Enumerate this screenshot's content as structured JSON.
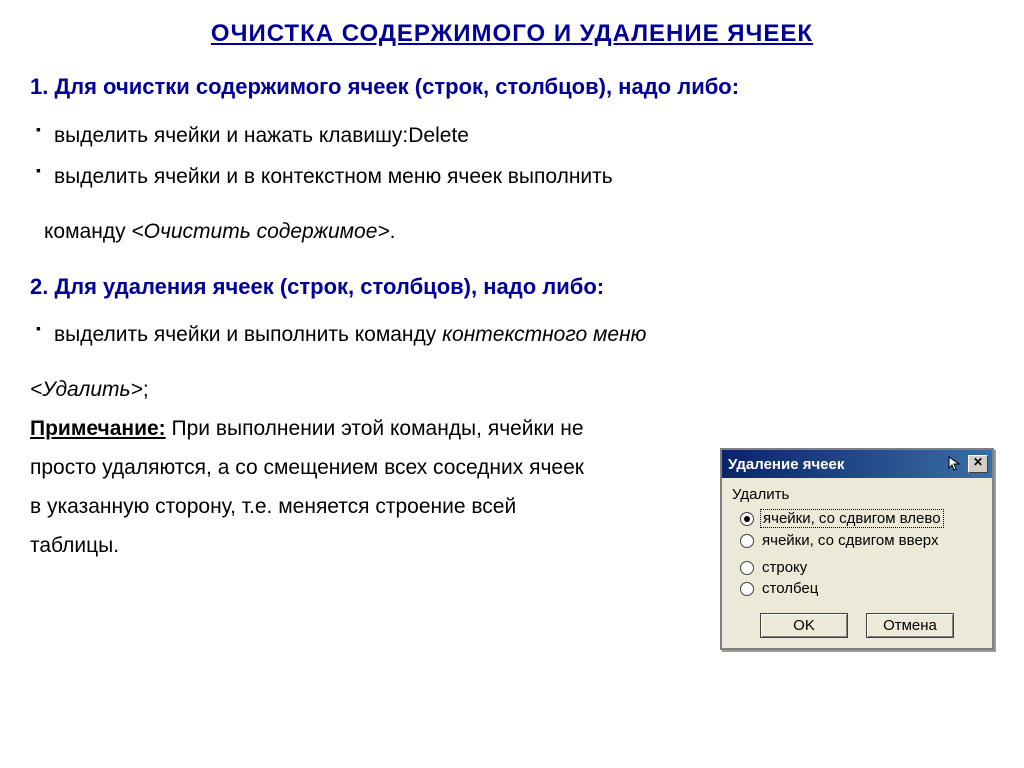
{
  "title": "ОЧИСТКА СОДЕРЖИМОГО И УДАЛЕНИЕ ЯЧЕЕК",
  "section1": {
    "heading": "1. Для очистки содержимого ячеек (строк, столбцов), надо либо:",
    "bullet1": "выделить ячейки и нажать клавишу:Delete",
    "bullet2a": "выделить ячейки и в контекстном меню ячеек выполнить",
    "bullet2b_prefix": "команду ",
    "bullet2b_cmd": "<Очистить содержимое>",
    "bullet2b_suffix": "."
  },
  "section2": {
    "heading": "2.  Для удаления ячеек (строк, столбцов), надо либо:",
    "bullet1a": "выделить ячейки и выполнить команду ",
    "bullet1a_italic": "контекстного меню",
    "bullet1b": "<Удалить>",
    "bullet1b_suffix": ";"
  },
  "note": {
    "label": "Примечание:",
    "text": " При выполнении этой команды, ячейки не просто удаляются, а со смещением всех соседних ячеек в указанную сторону, т.е. меняется строение всей таблицы."
  },
  "dialog": {
    "title": "Удаление ячеек",
    "group_label": "Удалить",
    "options": [
      "ячейки, со сдвигом влево",
      "ячейки, со сдвигом вверх",
      "строку",
      "столбец"
    ],
    "selected": 0,
    "ok": "OK",
    "cancel": "Отмена"
  }
}
